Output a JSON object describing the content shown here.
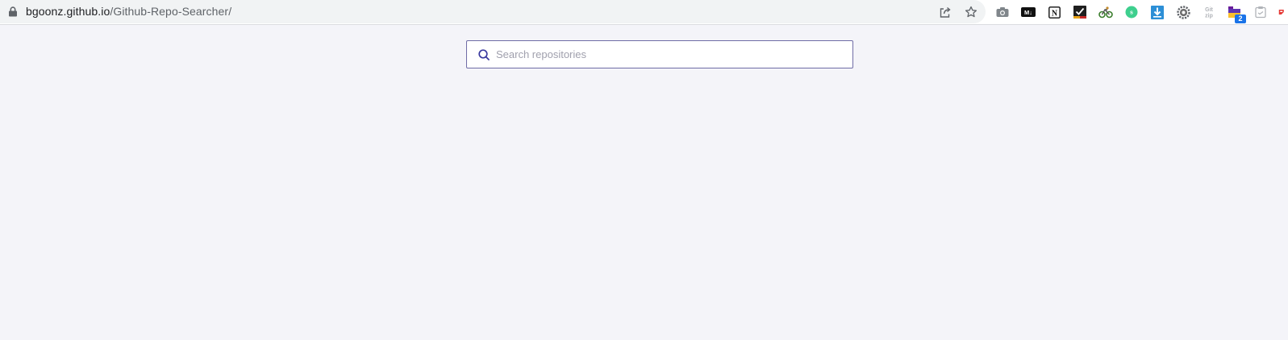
{
  "browser": {
    "url_host": "bgoonz.github.io",
    "url_path": "/Github-Repo-Searcher/",
    "extension_badge": "2",
    "extension_s_label": "s",
    "omnibox_icons": [
      "share-icon",
      "bookmark-star-icon"
    ],
    "extensions": [
      "camera-icon",
      "markdown-icon",
      "notion-icon",
      "checklist-icon",
      "bike-icon",
      "s-extension-icon",
      "download-icon",
      "gear-extension-icon",
      "gitzip-icon",
      "folder-extension-icon",
      "clipboard-extension-icon",
      "extension-cutoff-icon"
    ]
  },
  "search": {
    "placeholder": "Search repositories",
    "value": ""
  },
  "colors": {
    "page_background": "#f4f4f9",
    "search_border": "#6f6ca6",
    "search_icon": "#3b3aa0"
  }
}
